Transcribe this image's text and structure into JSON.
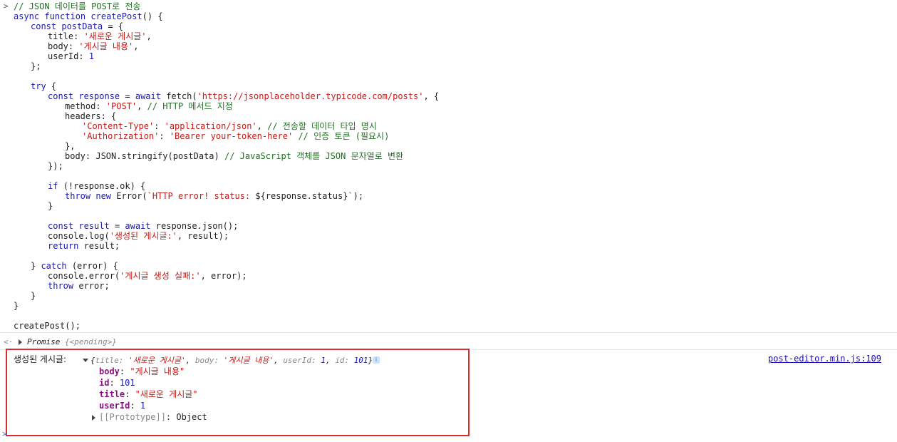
{
  "code_lines": [
    {
      "indent": 0,
      "segs": [
        {
          "t": "// JSON 데이터를 POST로 전송",
          "c": "cm"
        }
      ]
    },
    {
      "indent": 0,
      "segs": [
        {
          "t": "async ",
          "c": "kw"
        },
        {
          "t": "function ",
          "c": "kw"
        },
        {
          "t": "createPost",
          "c": "vr"
        },
        {
          "t": "() {",
          "c": "pl"
        }
      ]
    },
    {
      "indent": 1,
      "segs": [
        {
          "t": "const ",
          "c": "kw"
        },
        {
          "t": "postData",
          "c": "vr"
        },
        {
          "t": " = {",
          "c": "pl"
        }
      ]
    },
    {
      "indent": 2,
      "segs": [
        {
          "t": "title: ",
          "c": "pl"
        },
        {
          "t": "'새로운 게시글'",
          "c": "st"
        },
        {
          "t": ",",
          "c": "pl"
        }
      ]
    },
    {
      "indent": 2,
      "segs": [
        {
          "t": "body: ",
          "c": "pl"
        },
        {
          "t": "'게시글 내용'",
          "c": "st"
        },
        {
          "t": ",",
          "c": "pl"
        }
      ]
    },
    {
      "indent": 2,
      "segs": [
        {
          "t": "userId: ",
          "c": "pl"
        },
        {
          "t": "1",
          "c": "num"
        }
      ]
    },
    {
      "indent": 1,
      "segs": [
        {
          "t": "};",
          "c": "pl"
        }
      ]
    },
    {
      "indent": 0,
      "segs": [
        {
          "t": "",
          "c": "pl"
        }
      ]
    },
    {
      "indent": 1,
      "segs": [
        {
          "t": "try ",
          "c": "kw"
        },
        {
          "t": "{",
          "c": "pl"
        }
      ]
    },
    {
      "indent": 2,
      "segs": [
        {
          "t": "const ",
          "c": "kw"
        },
        {
          "t": "response",
          "c": "vr"
        },
        {
          "t": " = ",
          "c": "pl"
        },
        {
          "t": "await ",
          "c": "kw"
        },
        {
          "t": "fetch(",
          "c": "pl"
        },
        {
          "t": "'https://jsonplaceholder.typicode.com/posts'",
          "c": "st"
        },
        {
          "t": ", {",
          "c": "pl"
        }
      ]
    },
    {
      "indent": 3,
      "segs": [
        {
          "t": "method: ",
          "c": "pl"
        },
        {
          "t": "'POST'",
          "c": "st"
        },
        {
          "t": ", ",
          "c": "pl"
        },
        {
          "t": "// HTTP 메서드 지정",
          "c": "cm"
        }
      ]
    },
    {
      "indent": 3,
      "segs": [
        {
          "t": "headers: {",
          "c": "pl"
        }
      ]
    },
    {
      "indent": 4,
      "segs": [
        {
          "t": "'Content-Type'",
          "c": "st"
        },
        {
          "t": ": ",
          "c": "pl"
        },
        {
          "t": "'application/json'",
          "c": "st"
        },
        {
          "t": ", ",
          "c": "pl"
        },
        {
          "t": "// 전송할 데이터 타입 명시",
          "c": "cm"
        }
      ]
    },
    {
      "indent": 4,
      "segs": [
        {
          "t": "'Authorization'",
          "c": "st"
        },
        {
          "t": ": ",
          "c": "pl"
        },
        {
          "t": "'Bearer your-token-here'",
          "c": "st"
        },
        {
          "t": " ",
          "c": "pl"
        },
        {
          "t": "// 인증 토큰 (필요시)",
          "c": "cm"
        }
      ]
    },
    {
      "indent": 3,
      "segs": [
        {
          "t": "},",
          "c": "pl"
        }
      ]
    },
    {
      "indent": 3,
      "segs": [
        {
          "t": "body: JSON.stringify(postData) ",
          "c": "pl"
        },
        {
          "t": "// JavaScript 객체를 JSON 문자열로 변환",
          "c": "cm"
        }
      ]
    },
    {
      "indent": 2,
      "segs": [
        {
          "t": "});",
          "c": "pl"
        }
      ]
    },
    {
      "indent": 0,
      "segs": [
        {
          "t": "",
          "c": "pl"
        }
      ]
    },
    {
      "indent": 2,
      "segs": [
        {
          "t": "if ",
          "c": "kw"
        },
        {
          "t": "(!response.ok) {",
          "c": "pl"
        }
      ]
    },
    {
      "indent": 3,
      "segs": [
        {
          "t": "throw ",
          "c": "kw"
        },
        {
          "t": "new ",
          "c": "kw"
        },
        {
          "t": "Error(",
          "c": "pl"
        },
        {
          "t": "`HTTP error! status: ",
          "c": "st"
        },
        {
          "t": "${response.status}",
          "c": "pl"
        },
        {
          "t": "`",
          "c": "st"
        },
        {
          "t": ");",
          "c": "pl"
        }
      ]
    },
    {
      "indent": 2,
      "segs": [
        {
          "t": "}",
          "c": "pl"
        }
      ]
    },
    {
      "indent": 0,
      "segs": [
        {
          "t": "",
          "c": "pl"
        }
      ]
    },
    {
      "indent": 2,
      "segs": [
        {
          "t": "const ",
          "c": "kw"
        },
        {
          "t": "result",
          "c": "vr"
        },
        {
          "t": " = ",
          "c": "pl"
        },
        {
          "t": "await ",
          "c": "kw"
        },
        {
          "t": "response.json();",
          "c": "pl"
        }
      ]
    },
    {
      "indent": 2,
      "segs": [
        {
          "t": "console.log(",
          "c": "pl"
        },
        {
          "t": "'생성된 게시글:'",
          "c": "st"
        },
        {
          "t": ", result);",
          "c": "pl"
        }
      ]
    },
    {
      "indent": 2,
      "segs": [
        {
          "t": "return ",
          "c": "kw"
        },
        {
          "t": "result;",
          "c": "pl"
        }
      ]
    },
    {
      "indent": 0,
      "segs": [
        {
          "t": "",
          "c": "pl"
        }
      ]
    },
    {
      "indent": 1,
      "segs": [
        {
          "t": "} ",
          "c": "pl"
        },
        {
          "t": "catch ",
          "c": "kw"
        },
        {
          "t": "(error) {",
          "c": "pl"
        }
      ]
    },
    {
      "indent": 2,
      "segs": [
        {
          "t": "console.error(",
          "c": "pl"
        },
        {
          "t": "'게시글 생성 실패:'",
          "c": "st"
        },
        {
          "t": ", error);",
          "c": "pl"
        }
      ]
    },
    {
      "indent": 2,
      "segs": [
        {
          "t": "throw ",
          "c": "kw"
        },
        {
          "t": "error;",
          "c": "pl"
        }
      ]
    },
    {
      "indent": 1,
      "segs": [
        {
          "t": "}",
          "c": "pl"
        }
      ]
    },
    {
      "indent": 0,
      "segs": [
        {
          "t": "}",
          "c": "pl"
        }
      ]
    },
    {
      "indent": 0,
      "segs": [
        {
          "t": "",
          "c": "pl"
        }
      ]
    },
    {
      "indent": 0,
      "segs": [
        {
          "t": "createPost();",
          "c": "pl"
        }
      ]
    }
  ],
  "input_prompt": ">",
  "return_prompt": "<·",
  "promise_label": "Promise ",
  "promise_state": "{<pending>}",
  "log": {
    "label": "생성된 게시글:",
    "summary": {
      "open": "{",
      "title_key": "title",
      "title_val": "'새로운 게시글'",
      "body_key": "body",
      "body_val": "'게시글 내용'",
      "userid_key": "userId",
      "userid_val": "1",
      "id_key": "id",
      "id_val": "101",
      "close": "}"
    },
    "info_icon": "i",
    "props": [
      {
        "key": "body",
        "val": "\"게시글 내용\"",
        "type": "str"
      },
      {
        "key": "id",
        "val": "101",
        "type": "num"
      },
      {
        "key": "title",
        "val": "\"새로운 게시글\"",
        "type": "str"
      },
      {
        "key": "userId",
        "val": "1",
        "type": "num"
      }
    ],
    "prototype_key": "[[Prototype]]",
    "prototype_val": "Object",
    "source": "post-editor.min.js:109"
  },
  "bottom_prompt": ">",
  "colors": {
    "highlight_border": "#d32f2f",
    "link": "#1a0dab"
  }
}
